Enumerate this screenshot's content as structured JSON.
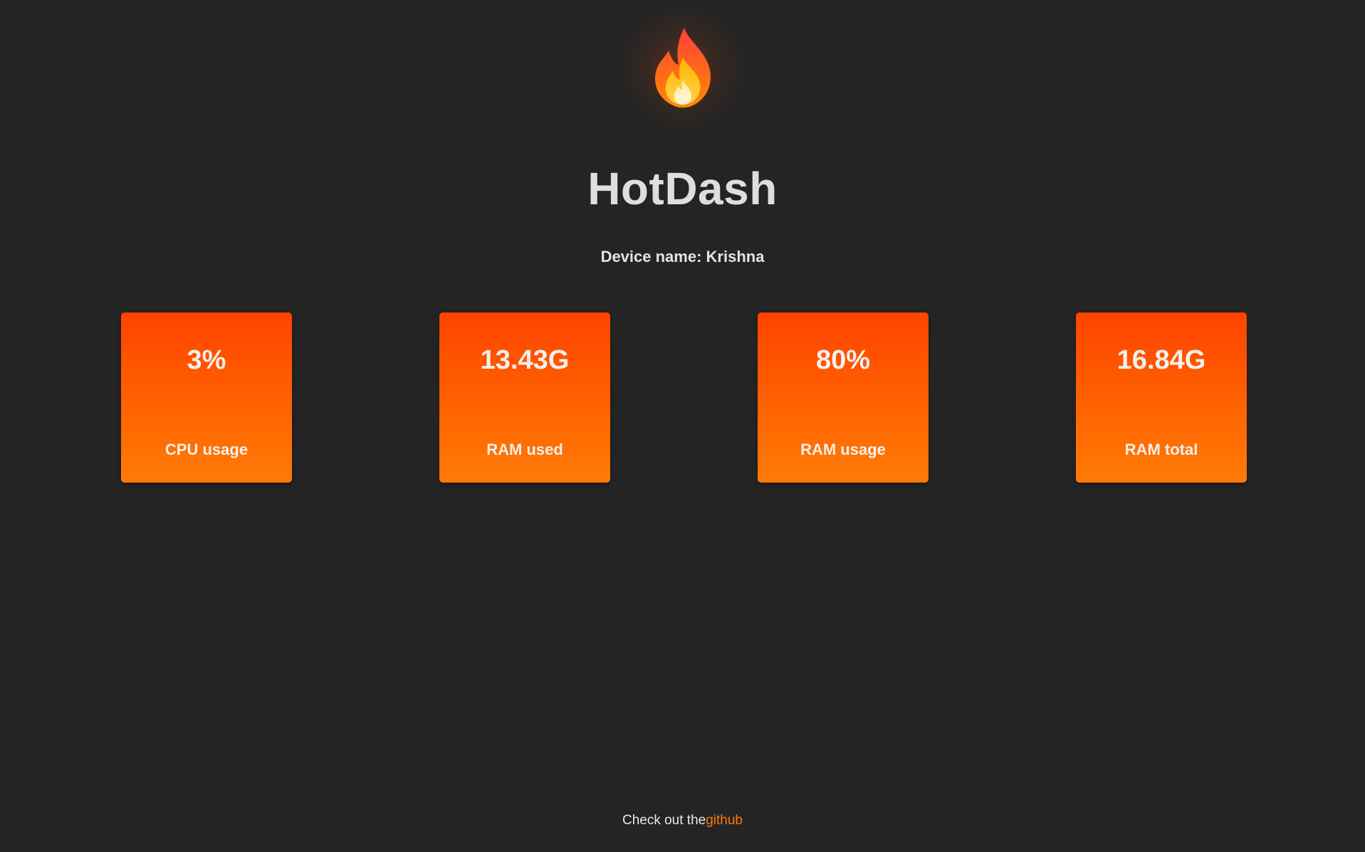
{
  "app": {
    "title": "HotDash",
    "logo_icon": "fire-icon",
    "device_label": "Device name: Krishna"
  },
  "stats": [
    {
      "value": "3%",
      "label": "CPU usage"
    },
    {
      "value": "13.43G",
      "label": "RAM used"
    },
    {
      "value": "80%",
      "label": "RAM usage"
    },
    {
      "value": "16.84G",
      "label": "RAM total"
    }
  ],
  "footer": {
    "prefix": "Check out the",
    "link_label": "github"
  },
  "colors": {
    "background": "#242424",
    "card_top": "#ff4300",
    "card_bottom": "#ff7a06",
    "link": "#ff7a0a",
    "text": "#dedede"
  }
}
